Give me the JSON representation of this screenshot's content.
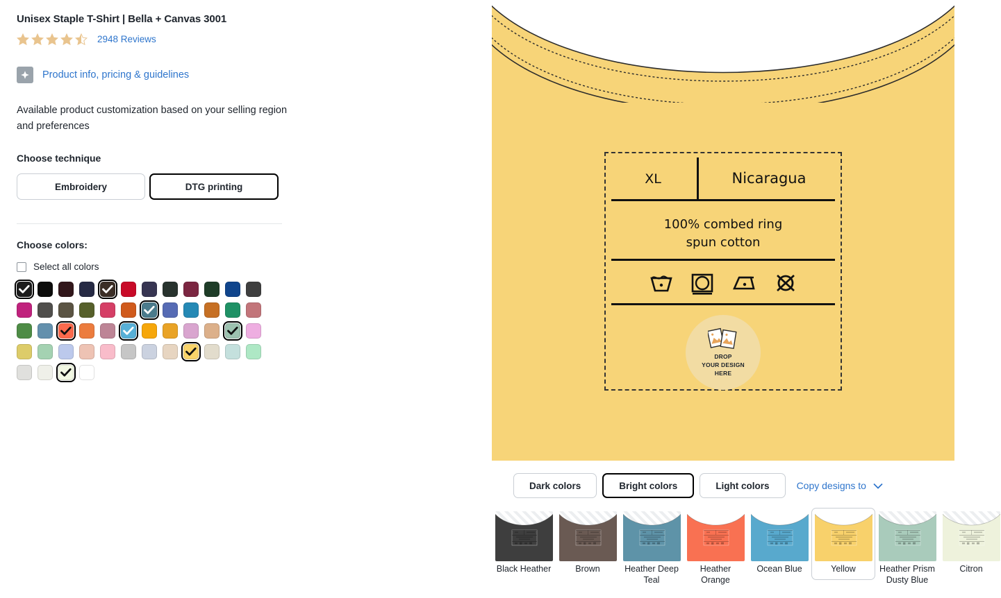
{
  "product": {
    "title": "Unisex Staple T-Shirt | Bella + Canvas 3001",
    "rating_value": 4.5,
    "reviews_label": "2948 Reviews",
    "info_link": "Product info, pricing & guidelines",
    "availability_text": "Available product customization based on your selling region and preferences",
    "star_color": "#e9c48e"
  },
  "technique": {
    "label": "Choose technique",
    "options": [
      {
        "label": "Embroidery",
        "selected": false
      },
      {
        "label": "DTG printing",
        "selected": true
      }
    ]
  },
  "colors": {
    "label": "Choose colors:",
    "select_all_label": "Select all colors",
    "select_all_checked": false,
    "rows": [
      [
        {
          "hex": "#1c1c1c",
          "selected": true
        },
        {
          "hex": "#0d0d0c",
          "selected": false
        },
        {
          "hex": "#32171b",
          "selected": false
        },
        {
          "hex": "#262a44",
          "selected": false
        },
        {
          "hex": "#3b2e26",
          "selected": true
        },
        {
          "hex": "#c80a28",
          "selected": false
        },
        {
          "hex": "#373552",
          "selected": false
        },
        {
          "hex": "#28332e",
          "selected": false
        },
        {
          "hex": "#7b2641",
          "selected": false
        },
        {
          "hex": "#1f3d28",
          "selected": false
        },
        {
          "hex": "#10458c",
          "selected": false
        },
        {
          "hex": "#3f3f3f",
          "selected": false
        }
      ],
      [
        {
          "hex": "#c0227d",
          "selected": false
        },
        {
          "hex": "#504f4c",
          "selected": false
        },
        {
          "hex": "#5b5443",
          "selected": false
        },
        {
          "hex": "#57602b",
          "selected": false
        },
        {
          "hex": "#d53f66",
          "selected": false
        },
        {
          "hex": "#d05a1c",
          "selected": false
        },
        {
          "hex": "#4b7b8c",
          "selected": true
        },
        {
          "hex": "#566bb4",
          "selected": false
        },
        {
          "hex": "#2589b5",
          "selected": false
        },
        {
          "hex": "#c67024",
          "selected": false
        },
        {
          "hex": "#1f9165",
          "selected": false
        },
        {
          "hex": "#c2757a",
          "selected": false
        }
      ],
      [
        {
          "hex": "#4e8c46",
          "selected": false
        },
        {
          "hex": "#6390ad",
          "selected": false
        },
        {
          "hex": "#fb6a4d",
          "selected": true
        },
        {
          "hex": "#ec7c3e",
          "selected": false
        },
        {
          "hex": "#bd8596",
          "selected": false
        },
        {
          "hex": "#58b0d7",
          "selected": true
        },
        {
          "hex": "#f6a70b",
          "selected": false
        },
        {
          "hex": "#e9a326",
          "selected": false
        },
        {
          "hex": "#d9a5cf",
          "selected": false
        },
        {
          "hex": "#dcb08a",
          "selected": false
        },
        {
          "hex": "#9dc2b0",
          "selected": true
        },
        {
          "hex": "#eeaee1",
          "selected": false
        }
      ],
      [
        {
          "hex": "#ddcc69",
          "selected": false
        },
        {
          "hex": "#a4d2b2",
          "selected": false
        },
        {
          "hex": "#bcc9ec",
          "selected": false
        },
        {
          "hex": "#eec3b4",
          "selected": false
        },
        {
          "hex": "#f9bcca",
          "selected": false
        },
        {
          "hex": "#c6c6c6",
          "selected": false
        },
        {
          "hex": "#cbd2e0",
          "selected": false
        },
        {
          "hex": "#e7d5c1",
          "selected": false
        },
        {
          "hex": "#f9d46a",
          "selected": true
        },
        {
          "hex": "#e2dccc",
          "selected": false
        },
        {
          "hex": "#c4e0dd",
          "selected": false
        },
        {
          "hex": "#aee8c5",
          "selected": false
        }
      ],
      [
        {
          "hex": "#e0e0dd",
          "selected": false
        },
        {
          "hex": "#eff0e9",
          "selected": false
        },
        {
          "hex": "#f2f8e3",
          "selected": true
        },
        {
          "hex": "#ffffff",
          "selected": false
        }
      ]
    ]
  },
  "preview": {
    "shirt_color": "#f7d478",
    "label": {
      "size": "XL",
      "country": "Nicaragua",
      "material_line1": "100% combed ring",
      "material_line2": "spun cotton",
      "care_icons": [
        "wash-tub-icon",
        "tumble-dry-icon",
        "iron-icon",
        "no-dry-clean-icon"
      ]
    },
    "drop_zone": {
      "line1": "DROP",
      "line2": "YOUR DESIGN",
      "line3": "HERE"
    }
  },
  "bottom": {
    "groups": [
      {
        "label": "Dark colors",
        "selected": false
      },
      {
        "label": "Bright colors",
        "selected": true
      },
      {
        "label": "Light colors",
        "selected": false
      }
    ],
    "copy_designs_label": "Copy designs to",
    "thumbnails": [
      {
        "label": "Black Heather",
        "hex": "#3e3e3e",
        "heather": true,
        "selected": false
      },
      {
        "label": "Brown",
        "hex": "#6a5a53",
        "heather": true,
        "selected": false
      },
      {
        "label": "Heather Deep Teal",
        "hex": "#5e93a8",
        "heather": true,
        "selected": false
      },
      {
        "label": "Heather Orange",
        "hex": "#f97152",
        "heather": false,
        "selected": false
      },
      {
        "label": "Ocean Blue",
        "hex": "#58a9cd",
        "heather": false,
        "selected": false
      },
      {
        "label": "Yellow",
        "hex": "#f8d16b",
        "heather": false,
        "selected": true
      },
      {
        "label": "Heather Prism Dusty Blue",
        "hex": "#a9cbbb",
        "heather": true,
        "selected": false
      },
      {
        "label": "Citron",
        "hex": "#eef2dc",
        "heather": true,
        "selected": false
      }
    ]
  }
}
